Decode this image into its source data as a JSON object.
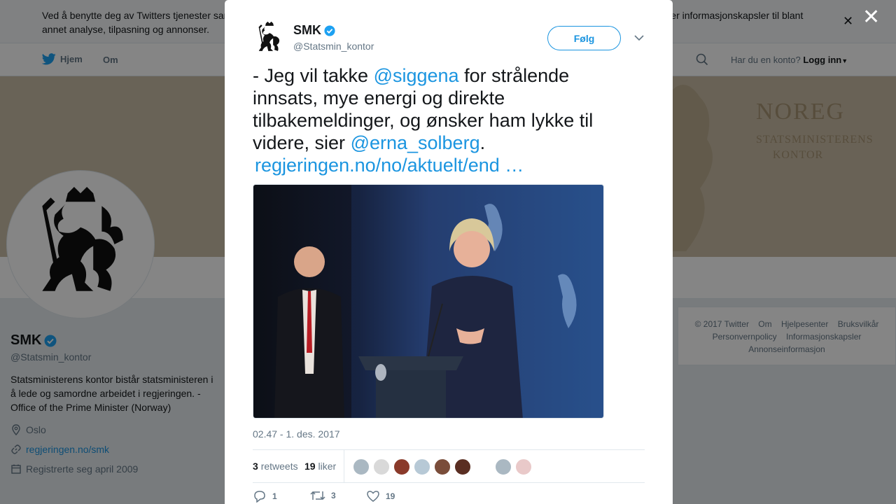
{
  "cookie_bar": {
    "text": "Ved å benytte deg av Twitters tjenester samtykker du til vår bruk av informasjonskapsler. Vi og våre samarbeidspartnere opererer globalt, og bruker informasjonskapsler til blant annet analyse, tilpasning og annonser.",
    "close_icon": "close-icon"
  },
  "nav": {
    "home": "Hjem",
    "about": "Om",
    "account_question": "Har du en konto?",
    "login": "Logg inn"
  },
  "banner": {
    "title": "NOREG",
    "subtitle": "STATSMINISTERENS KONTOR",
    "colors": {
      "background": "#c9bda6",
      "text": "#a89474"
    }
  },
  "profile": {
    "name": "SMK",
    "handle": "@Statsmin_kontor",
    "bio": "Statsministerens kontor bistår statsministeren i å lede og samordne arbeidet i regjeringen. - Office of the Prime Minister (Norway)",
    "location": "Oslo",
    "website": "regjeringen.no/smk",
    "joined": "Registrerte seg april 2009"
  },
  "footer": {
    "links": [
      "© 2017 Twitter",
      "Om",
      "Hjelpesenter",
      "Bruksvilkår",
      "Personvernpolicy",
      "Informasjonskapsler",
      "Annonseinformasjon"
    ]
  },
  "modal": {
    "author_name": "SMK",
    "author_handle": "@Statsmin_kontor",
    "follow_label": "Følg",
    "tweet": {
      "part1": "- Jeg vil takke ",
      "mention1": "@siggena",
      "part2": " for strålende innsats, mye energi og direkte tilbakemeldinger, og ønsker ham lykke til videre, sier ",
      "mention2": "@erna_solberg",
      "part3": ".",
      "link": "regjeringen.no/no/aktuelt/end …"
    },
    "timestamp": "02.47 - 1. des. 2017",
    "retweets_count": "3",
    "retweets_label": "retweets",
    "likes_count": "19",
    "likes_label": "liker",
    "actions": {
      "reply": "1",
      "retweet": "3",
      "like": "19"
    }
  },
  "colors": {
    "accent": "#1b95e0",
    "verified": "#1da1f2"
  }
}
